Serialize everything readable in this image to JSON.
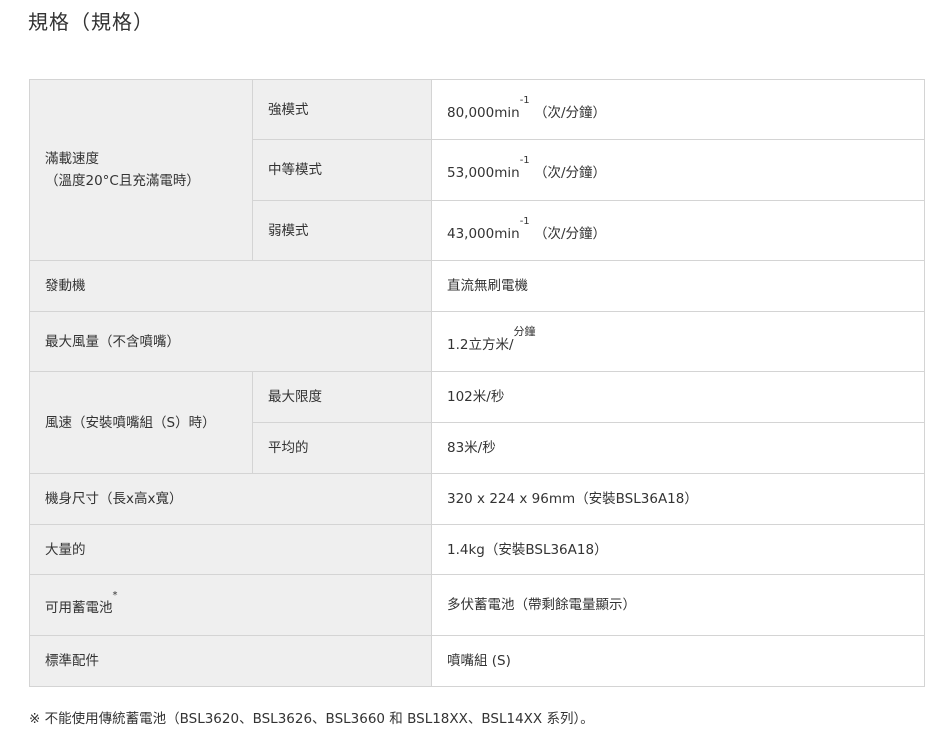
{
  "page": {
    "title": "規格（規格）"
  },
  "table": {
    "rows": [
      {
        "label": "滿載速度",
        "label2": "（溫度20°C且充滿電時）"
      },
      {
        "sub": "強模式",
        "value": "80,000min",
        "sup": "-1",
        "unit": "（次/分鐘）"
      },
      {
        "sub": "中等模式",
        "value": "53,000min",
        "sup": "-1",
        "unit": "（次/分鐘）"
      },
      {
        "sub": "弱模式",
        "value": "43,000min",
        "sup": "-1",
        "unit": "（次/分鐘）"
      },
      {
        "label": "發動機",
        "value": "直流無刷電機"
      },
      {
        "label": "最大風量（不含噴嘴）",
        "value": "1.2立方米/",
        "sup": "分鐘"
      },
      {
        "label": "風速（安裝噴嘴組（S）時）"
      },
      {
        "sub": "最大限度",
        "value": "102米/秒"
      },
      {
        "sub": "平均的",
        "value": "83米/秒"
      },
      {
        "label": "機身尺寸（長x高x寬）",
        "value": "320 x 224 x 96mm（安裝BSL36A18）"
      },
      {
        "label": "大量的",
        "value": "1.4kg（安裝BSL36A18）"
      },
      {
        "label": "可用蓄電池",
        "sup": "*",
        "value": "多伏蓄電池（帶剩餘電量顯示）"
      },
      {
        "label": "標準配件",
        "value": "噴嘴組 (S)"
      }
    ]
  },
  "footnote": "※ 不能使用傳統蓄電池（BSL3620、BSL3626、BSL3660 和 BSL18XX、BSL14XX 系列）。"
}
